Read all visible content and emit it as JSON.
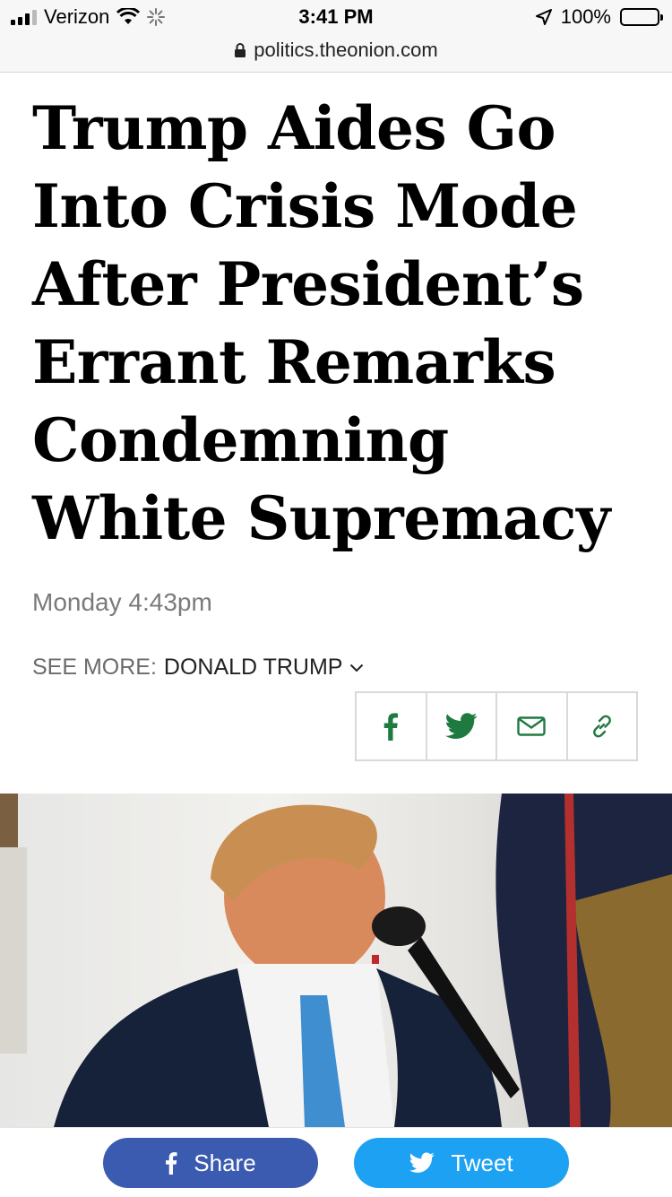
{
  "status_bar": {
    "carrier": "Verizon",
    "time": "3:41 PM",
    "battery": "100%",
    "icons": [
      "signal-bars-icon",
      "wifi-icon",
      "activity-spinner-icon",
      "location-arrow-icon",
      "battery-icon"
    ]
  },
  "url_bar": {
    "domain": "politics.theonion.com",
    "icon": "lock-icon"
  },
  "article": {
    "headline": "Trump Aides Go Into Crisis Mode After President’s Errant Remarks Condemning White Supremacy",
    "dateline": "Monday 4:43pm",
    "see_more_label": "SEE MORE:",
    "see_more_topic": "DONALD TRUMP"
  },
  "share_icons": [
    "facebook-icon",
    "twitter-icon",
    "email-icon",
    "link-icon"
  ],
  "bottom_bar": {
    "share_label": "Share",
    "tweet_label": "Tweet"
  },
  "colors": {
    "accent_green": "#1f7a3f",
    "facebook_blue": "#3b5bb0",
    "twitter_blue": "#1da1f2"
  }
}
